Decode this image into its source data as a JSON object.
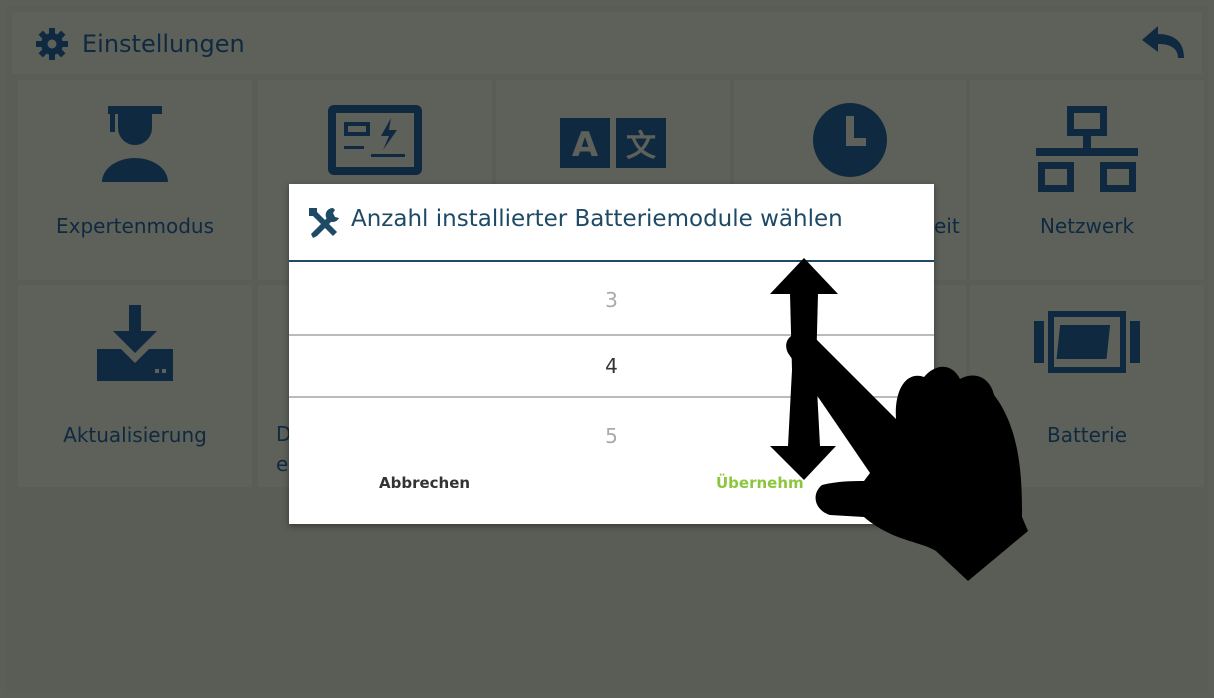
{
  "header": {
    "title": "Einstellungen"
  },
  "tiles": [
    {
      "label": "Expertenmodus",
      "icon": "graduate-icon"
    },
    {
      "label": "",
      "icon": "battery-meter-icon"
    },
    {
      "label": "",
      "icon": "language-icon"
    },
    {
      "label": "eit",
      "icon": "clock-icon"
    },
    {
      "label": "Netzwerk",
      "icon": "network-icon"
    },
    {
      "label": "Aktualisierung",
      "icon": "download-icon"
    },
    {
      "label": "D",
      "icon": ""
    },
    {
      "label": "e",
      "icon": ""
    },
    {
      "label": "Batterie",
      "icon": "battery-icon"
    }
  ],
  "dialog": {
    "title": "Anzahl installierter Batteriemodule wählen",
    "picker": {
      "above": "3",
      "selected": "4",
      "below": "5"
    },
    "cancel_label": "Abbrechen",
    "ok_label": "Übernehm"
  },
  "colors": {
    "accent": "#1e4a66",
    "ok": "#8cc63f",
    "dim": "#5c5e58"
  }
}
